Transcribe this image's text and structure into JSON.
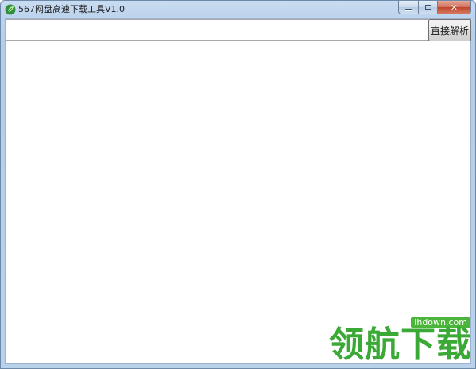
{
  "window": {
    "title": "567网盘高速下载工具V1.0",
    "icon": "app-leaf-icon",
    "caption_buttons": {
      "minimize": "minimize-icon",
      "maximize": "maximize-icon",
      "close": "close-icon"
    }
  },
  "toolbar": {
    "url_value": "",
    "url_placeholder": "",
    "parse_button_label": "直接解析"
  },
  "watermark": {
    "url": "lhdown.com",
    "text": "领航下载"
  },
  "colors": {
    "title_bar": "#c9dcf1",
    "close_button": "#c0462c",
    "watermark_green": "#3aa935"
  }
}
